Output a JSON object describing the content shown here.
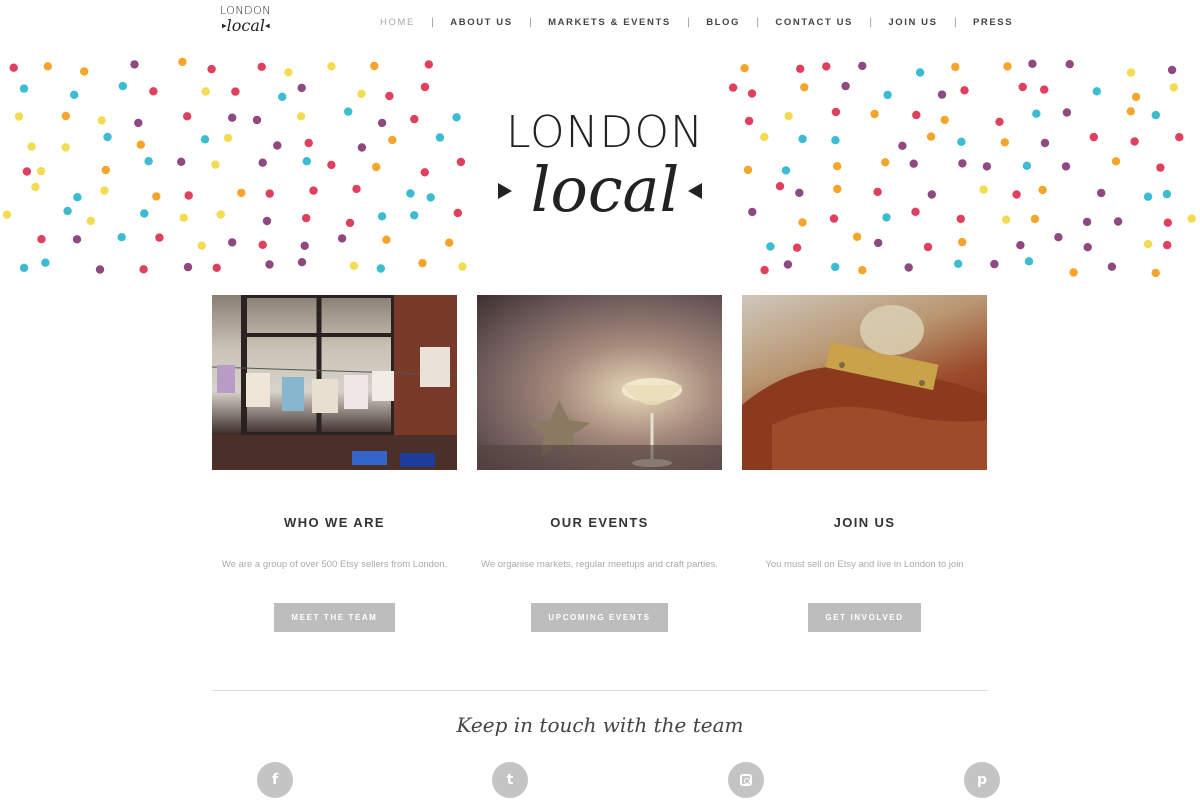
{
  "header": {
    "logo_line1": "LONDON",
    "logo_line2": "local"
  },
  "nav": [
    {
      "label": "HOME",
      "active": true
    },
    {
      "label": "ABOUT US"
    },
    {
      "label": "MARKETS & EVENTS"
    },
    {
      "label": "BLOG"
    },
    {
      "label": "CONTACT US"
    },
    {
      "label": "JOIN US"
    },
    {
      "label": "PRESS"
    }
  ],
  "banner": {
    "logo_line1": "LONDON",
    "logo_line2": "local",
    "dot_colors": [
      "#e0405e",
      "#3bbcd0",
      "#f4a52a",
      "#8e4a7e",
      "#f2dc52"
    ]
  },
  "features": [
    {
      "title": "WHO WE ARE",
      "text": "We are a group of over 500 Etsy sellers from London.",
      "button": "MEET THE TEAM"
    },
    {
      "title": "OUR EVENTS",
      "text": "We organise markets, regular meetups and craft parties.",
      "button": "UPCOMING EVENTS"
    },
    {
      "title": "JOIN US",
      "text": "You must sell on Etsy and live in London to join",
      "button": "GET INVOLVED"
    }
  ],
  "footer": {
    "keep_in_touch": "Keep in touch with the team",
    "social": [
      {
        "icon": "facebook-icon",
        "glyph": "f"
      },
      {
        "icon": "twitter-icon",
        "glyph": "t"
      },
      {
        "icon": "instagram-icon",
        "glyph": ""
      },
      {
        "icon": "pinterest-icon",
        "glyph": "p"
      }
    ]
  },
  "colors": {
    "button_bg": "#bdbdbd",
    "social_bg": "#c4c4c4"
  }
}
